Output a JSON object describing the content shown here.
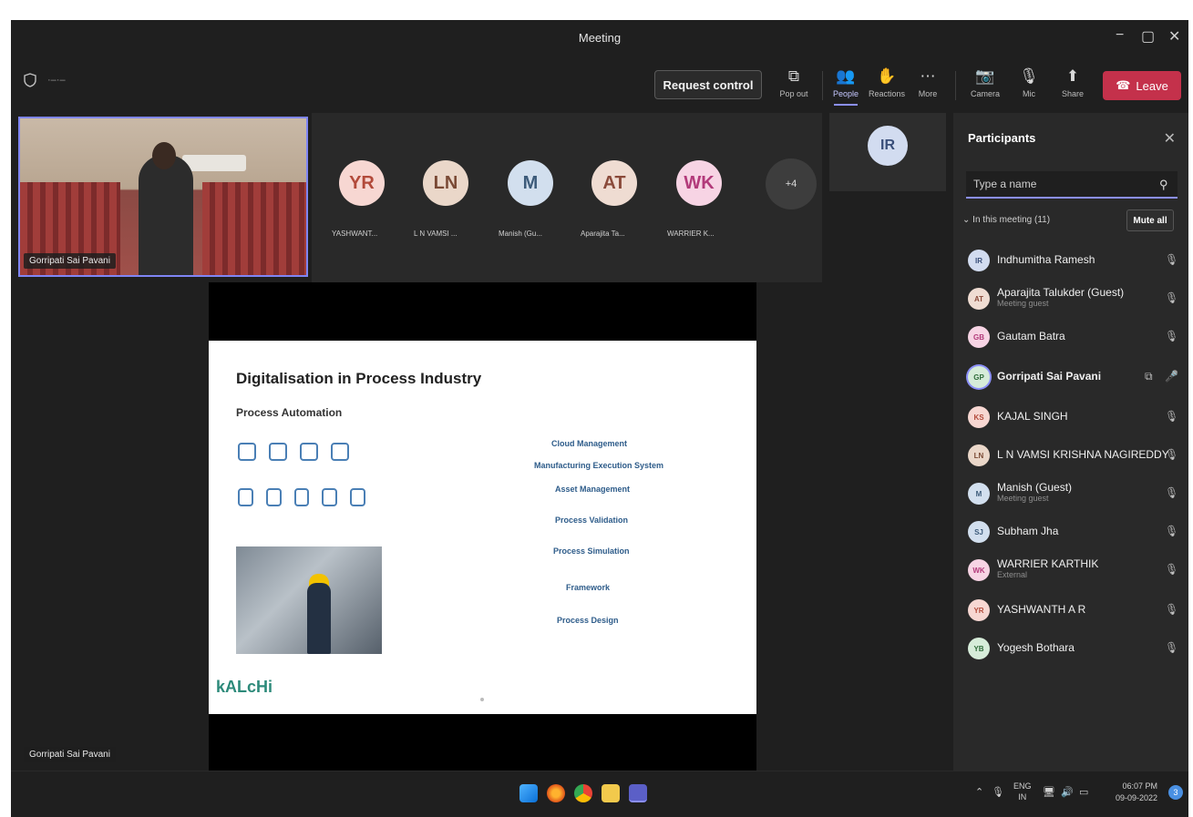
{
  "window": {
    "title": "Meeting",
    "controls": [
      "−",
      "▢",
      "✕"
    ]
  },
  "toolbar": {
    "left_icons": [
      "shield-icon",
      "more-dots-icon"
    ],
    "request_control": "Request control",
    "pop_out": "Pop out",
    "people": "People",
    "reactions": "Reactions",
    "more": "More",
    "camera": "Camera",
    "mic": "Mic",
    "share": "Share",
    "leave": "Leave",
    "leave_color": "#c4314b",
    "accent": "#8b8ff8"
  },
  "stage": {
    "self_video_name": "Gorripati Sai Pavani",
    "bottom_name": "Gorripati Sai Pavani",
    "tiles": [
      {
        "initials": "YR",
        "label": "YASHWANT...",
        "bg": "#f7d7d2",
        "fg": "#b24a3a"
      },
      {
        "initials": "LN",
        "label": "L N VAMSI ...",
        "bg": "#ead7c9",
        "fg": "#7a4a35"
      },
      {
        "initials": "M",
        "label": "Manish (Gu...",
        "bg": "#d2dfee",
        "fg": "#3d5b7a"
      },
      {
        "initials": "AT",
        "label": "Aparajita Ta...",
        "bg": "#efdcd2",
        "fg": "#8a4a3a"
      },
      {
        "initials": "WK",
        "label": "WARRIER K...",
        "bg": "#f7d4e4",
        "fg": "#b23a7a"
      }
    ],
    "more_count": "+4",
    "ir_tile": "IR"
  },
  "slide": {
    "title": "Digitalisation in Process Industry",
    "subtitle": "Process Automation",
    "items": [
      "Cloud Management",
      "Manufacturing Execution System",
      "Asset Management",
      "Process Validation",
      "Process Simulation",
      "Framework",
      "Process Design"
    ],
    "logo": "kALcHi"
  },
  "participants": {
    "title": "Participants",
    "search_placeholder": "Type a name",
    "in_meeting": "In this meeting (11)",
    "mute_all": "Mute all",
    "list": [
      {
        "initials": "IR",
        "name": "Indhumitha Ramesh",
        "sub": "",
        "bg": "#d2dcf0",
        "fg": "#3a4f7a"
      },
      {
        "initials": "AT",
        "name": "Aparajita Talukder (Guest)",
        "sub": "Meeting guest",
        "bg": "#efdcd2",
        "fg": "#8a4a3a"
      },
      {
        "initials": "GB",
        "name": "Gautam Batra",
        "sub": "",
        "bg": "#f7d4e4",
        "fg": "#b23a7a"
      },
      {
        "initials": "GP",
        "name": "Gorripati Sai Pavani",
        "sub": "",
        "bg": "#d6ecd9",
        "fg": "#2f6b3a"
      },
      {
        "initials": "KS",
        "name": "KAJAL SINGH",
        "sub": "",
        "bg": "#f7d7d2",
        "fg": "#b24a3a"
      },
      {
        "initials": "LN",
        "name": "L N VAMSI KRISHNA NAGIREDDY",
        "sub": "",
        "bg": "#ead7c9",
        "fg": "#7a4a35"
      },
      {
        "initials": "M",
        "name": "Manish (Guest)",
        "sub": "Meeting guest",
        "bg": "#d2dfee",
        "fg": "#3d5b7a"
      },
      {
        "initials": "SJ",
        "name": "Subham Jha",
        "sub": "",
        "bg": "#d2dfee",
        "fg": "#3d5b7a"
      },
      {
        "initials": "WK",
        "name": "WARRIER KARTHIK",
        "sub": "External",
        "bg": "#f7d4e4",
        "fg": "#b23a7a"
      },
      {
        "initials": "YR",
        "name": "YASHWANTH A R",
        "sub": "",
        "bg": "#f7d7d2",
        "fg": "#b24a3a"
      },
      {
        "initials": "YB",
        "name": "Yogesh Bothara",
        "sub": "",
        "bg": "#d6ecd9",
        "fg": "#2f6b3a"
      }
    ]
  },
  "taskbar": {
    "lang": "ENG",
    "region": "IN",
    "time": "06:07 PM",
    "date": "09-09-2022",
    "notif": "3"
  }
}
